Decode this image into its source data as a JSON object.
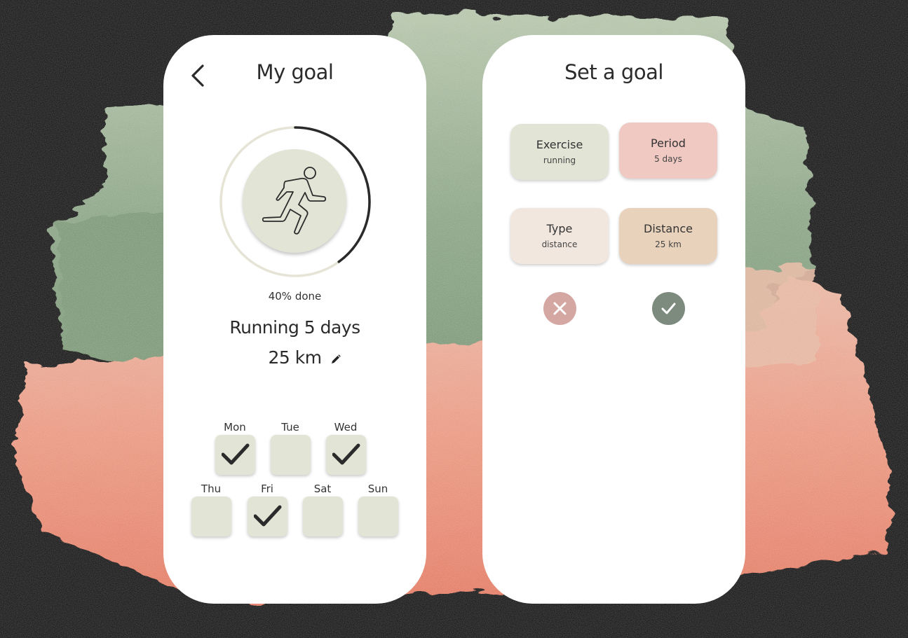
{
  "colors": {
    "background": "#1e1e1e",
    "sage": "#e2e4d6",
    "pink": "#efc9c2",
    "cream": "#f2e7df",
    "tan": "#e8d2bb",
    "cancel": "#d4a7a3",
    "confirm": "#7d8a7e",
    "ring_track": "#e5e4d6",
    "ring_progress": "#2a2a2a"
  },
  "my_goal": {
    "title": "My goal",
    "back_icon": "chevron-left-icon",
    "progress_percent": 40,
    "progress_label": "40% done",
    "runner_icon": "running-person-icon",
    "goal_text": "Running 5 days",
    "distance_text": "25 km",
    "edit_icon": "pencil-icon",
    "days": [
      {
        "label": "Mon",
        "checked": true
      },
      {
        "label": "Tue",
        "checked": false
      },
      {
        "label": "Wed",
        "checked": true
      },
      {
        "label": "Thu",
        "checked": false
      },
      {
        "label": "Fri",
        "checked": true
      },
      {
        "label": "Sat",
        "checked": false
      },
      {
        "label": "Sun",
        "checked": false
      }
    ]
  },
  "set_goal": {
    "title": "Set a goal",
    "tiles": [
      {
        "label": "Exercise",
        "value": "running"
      },
      {
        "label": "Period",
        "value": "5 days"
      },
      {
        "label": "Type",
        "value": "distance"
      },
      {
        "label": "Distance",
        "value": "25 km"
      }
    ],
    "cancel_icon": "close-icon",
    "confirm_icon": "check-icon"
  }
}
